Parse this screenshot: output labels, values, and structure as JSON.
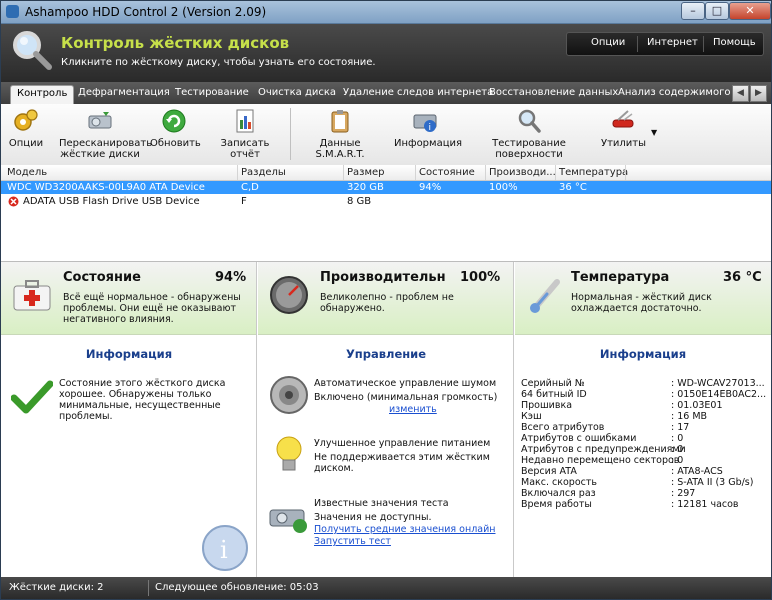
{
  "window": {
    "title": "Ashampoo HDD Control 2 (Version 2.09)",
    "min": "–",
    "max": "□",
    "close": "✕"
  },
  "header": {
    "title": "Контроль жёстких дисков",
    "subtitle": "Кликните по жёсткому диску, чтобы узнать его состояние.",
    "nav": [
      "Опции",
      "Интернет",
      "Помощь"
    ]
  },
  "tabs": [
    "Контроль",
    "Дефрагментация",
    "Тестирование",
    "Очистка диска",
    "Удаление следов интернета",
    "Восстановление данных",
    "Анализ содержимого"
  ],
  "toolbar": {
    "options": "Опции",
    "rescan_1": "Пересканировать",
    "rescan_2": "жёсткие диски",
    "refresh": "Обновить",
    "report": "Записать отчёт",
    "smart": "Данные S.M.A.R.T.",
    "info": "Информация",
    "surface": "Тестирование поверхности",
    "utilities": "Утилиты"
  },
  "columns": [
    "Модель",
    "Разделы",
    "Размер",
    "Состояние",
    "Производи...",
    "Температура"
  ],
  "drives": [
    {
      "model": "WDC WD3200AAKS-00L9A0 ATA Device",
      "partitions": "C,D",
      "size": "320 GB",
      "state": "94%",
      "performance": "100%",
      "temperature": "36 °C"
    },
    {
      "model": "ADATA USB Flash Drive USB Device",
      "partitions": "F",
      "size": "8 GB",
      "state": "",
      "performance": "",
      "temperature": ""
    }
  ],
  "state_panel": {
    "title": "Состояние",
    "value": "94%",
    "desc": "Всё ещё нормальное - обнаружены проблемы. Они ещё не оказывают негативного влияния.",
    "section": "Информация",
    "info": "Состояние этого жёсткого диска хорошее. Обнаружены только минимальные, несущественные проблемы."
  },
  "perf_panel": {
    "title": "Производительн",
    "value": "100%",
    "desc": "Великолепно - проблем не обнаружено.",
    "section": "Управление",
    "noise_title": "Автоматическое управление шумом",
    "noise_state": "Включено (минимальная громкость)",
    "noise_change": "изменить",
    "power_title": "Улучшенное управление питанием",
    "power_state": "Не поддерживается этим жёстким диском.",
    "bench_title": "Известные значения теста",
    "bench_state": "Значения не доступны.",
    "bench_link1": "Получить средние значения онлайн",
    "bench_link2": "Запустить тест"
  },
  "temp_panel": {
    "title": "Температура",
    "value": "36 °C",
    "desc": "Нормальная - жёсткий диск охлаждается достаточно.",
    "section": "Информация",
    "rows": [
      {
        "k": "Серийный №",
        "v": ": WD-WCAV27013..."
      },
      {
        "k": "64 битный ID",
        "v": ": 0150E14EB0AC2..."
      },
      {
        "k": "Прошивка",
        "v": ": 01.03E01"
      },
      {
        "k": "Кэш",
        "v": ": 16 MB"
      },
      {
        "k": "Всего атрибутов",
        "v": ": 17"
      },
      {
        "k": "Атрибутов с ошибками",
        "v": ": 0"
      },
      {
        "k": "Атрибутов с предупреждениями",
        "v": ": 0"
      },
      {
        "k": "Недавно перемещено секторов",
        "v": ": 0"
      },
      {
        "k": "Версия ATA",
        "v": ": ATA8-ACS"
      },
      {
        "k": "Макс. скорость",
        "v": ": S-ATA II (3 Gb/s)"
      },
      {
        "k": "Включался раз",
        "v": ": 297"
      },
      {
        "k": "Время работы",
        "v": ": 12181 часов"
      }
    ]
  },
  "status": {
    "drives": "Жёсткие диски: 2",
    "next_update": "Следующее обновление: 05:03"
  }
}
